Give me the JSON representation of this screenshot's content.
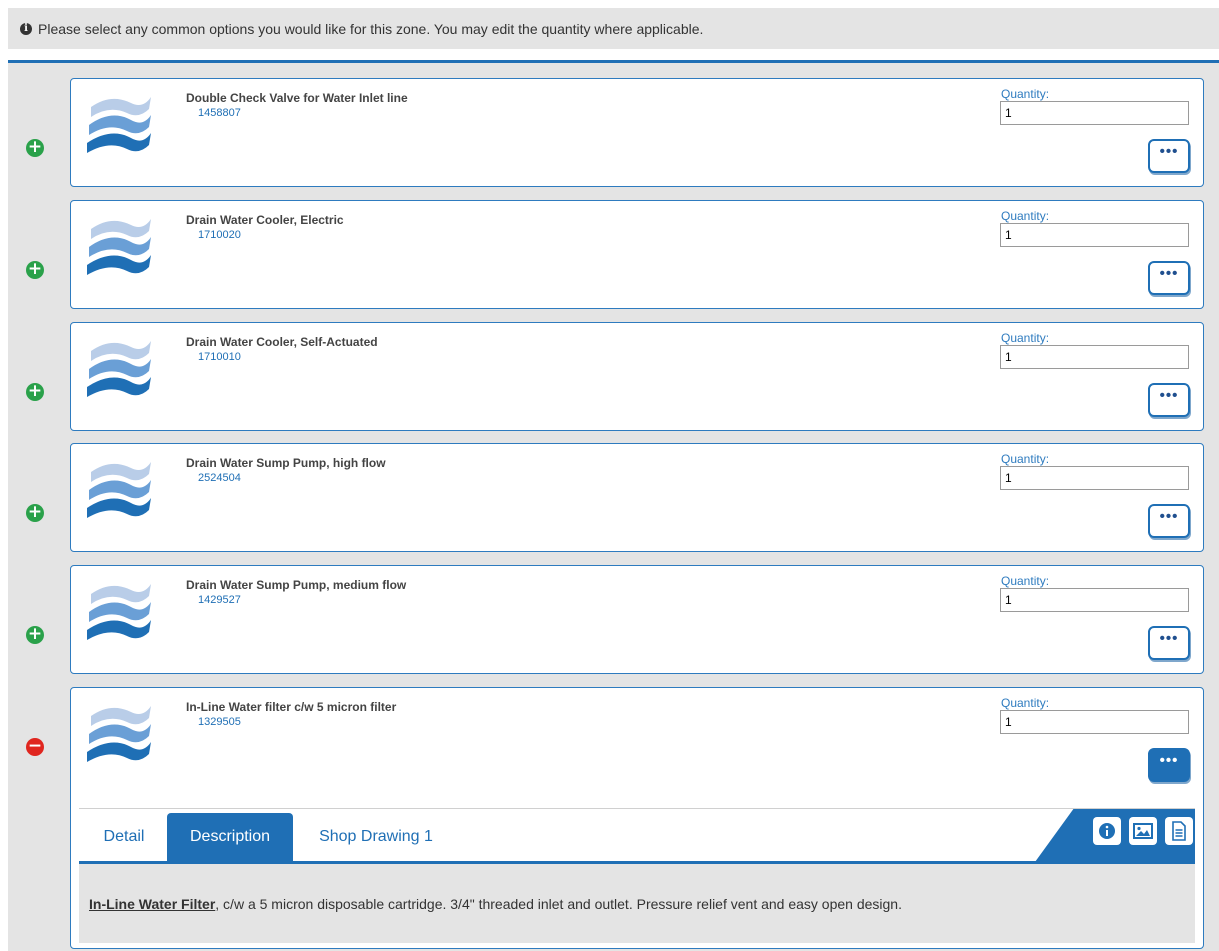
{
  "notice": {
    "icon": "info-icon",
    "text": "Please select any common options you would like for this zone. You may edit the quantity where applicable."
  },
  "items": [
    {
      "name": "Double Check Valve for Water Inlet line",
      "code": "1458807",
      "quantity_label": "Quantity:",
      "quantity": "1",
      "selected": false
    },
    {
      "name": "Drain Water Cooler, Electric",
      "code": "1710020",
      "quantity_label": "Quantity:",
      "quantity": "1",
      "selected": false
    },
    {
      "name": "Drain Water Cooler, Self-Actuated",
      "code": "1710010",
      "quantity_label": "Quantity:",
      "quantity": "1",
      "selected": false
    },
    {
      "name": "Drain Water Sump Pump, high flow",
      "code": "2524504",
      "quantity_label": "Quantity:",
      "quantity": "1",
      "selected": false
    },
    {
      "name": "Drain Water Sump Pump, medium flow",
      "code": "1429527",
      "quantity_label": "Quantity:",
      "quantity": "1",
      "selected": false
    },
    {
      "name": "In-Line Water filter c/w 5 micron filter",
      "code": "1329505",
      "quantity_label": "Quantity:",
      "quantity": "1",
      "selected": true
    }
  ],
  "more_button_label": "•••",
  "detail": {
    "tabs": [
      {
        "label": "Detail",
        "active": false
      },
      {
        "label": "Description",
        "active": true
      },
      {
        "label": "Shop Drawing 1",
        "active": false
      }
    ],
    "tools": [
      "info-icon",
      "image-icon",
      "document-icon"
    ],
    "description_title": "In-Line Water Filter",
    "description_text": ", c/w a 5 micron disposable cartridge. 3/4\" threaded inlet and outlet. Pressure relief vent and easy open design."
  },
  "colors": {
    "accent": "#1f6fb5",
    "add": "#2aa14a",
    "remove": "#e0261f",
    "panel_bg": "#e4e4e4"
  }
}
